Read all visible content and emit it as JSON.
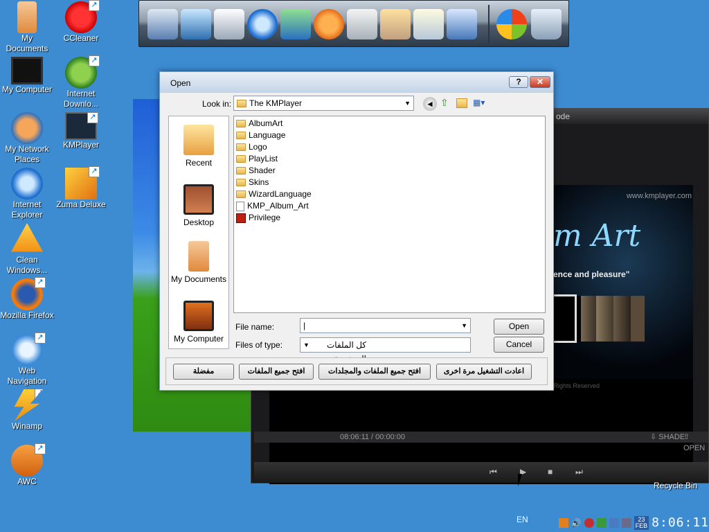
{
  "desktop": {
    "icons": [
      {
        "label": "My Documents",
        "icon": "folder-icon"
      },
      {
        "label": "CCleaner",
        "icon": "ccleaner-icon"
      },
      {
        "label": "My Computer",
        "icon": "computer-icon"
      },
      {
        "label": "Internet Downlo...",
        "icon": "download-manager-icon"
      },
      {
        "label": "My Network Places",
        "icon": "network-icon"
      },
      {
        "label": "KMPlayer",
        "icon": "kmplayer-icon"
      },
      {
        "label": "Internet Explorer",
        "icon": "ie-icon"
      },
      {
        "label": "Zuma Deluxe",
        "icon": "zuma-icon"
      },
      {
        "label": "Clean Windows...",
        "icon": "clean-icon"
      },
      {
        "label": "Mozilla Firefox",
        "icon": "firefox-icon"
      },
      {
        "label": "Web Navigation",
        "icon": "web-icon"
      },
      {
        "label": "Winamp",
        "icon": "winamp-icon"
      },
      {
        "label": "AWC",
        "icon": "awc-icon"
      }
    ],
    "recycle_bin": "Recycle Bin"
  },
  "kmplayer": {
    "title": "ode",
    "site": "www.kmplayer.com",
    "headline": "m Art",
    "tagline": "ence and pleasure\"",
    "rights": "ll Rights Reserved",
    "time": "08:06:11 / 00:00:00",
    "shade": "SHADE",
    "open": "OPEN"
  },
  "dialog": {
    "title": "Open",
    "look_in_label": "Look in:",
    "look_in_value": "The KMPlayer",
    "places": [
      "Recent",
      "Desktop",
      "My Documents",
      "My Computer"
    ],
    "files": [
      {
        "name": "AlbumArt",
        "type": "folder"
      },
      {
        "name": "Language",
        "type": "folder"
      },
      {
        "name": "Logo",
        "type": "folder"
      },
      {
        "name": "PlayList",
        "type": "folder"
      },
      {
        "name": "Shader",
        "type": "folder"
      },
      {
        "name": "Skins",
        "type": "folder"
      },
      {
        "name": "WizardLanguage",
        "type": "folder"
      },
      {
        "name": "KMP_Album_Art",
        "type": "file"
      },
      {
        "name": "Privilege",
        "type": "file"
      }
    ],
    "filename_label": "File name:",
    "filename_value": "|",
    "filetype_label": "Files of type:",
    "filetype_value": "كل الملفات المدعومة",
    "open_button": "Open",
    "cancel_button": "Cancel",
    "bottom_buttons": [
      "مفضلة",
      "افتح جميع الملفات",
      "افتح جميع الملفات والمجلدات",
      "اعادت التشغيل مرة اخرى"
    ]
  },
  "taskbar": {
    "lang": "EN",
    "date_day": "23",
    "date_month": "FEB",
    "clock": "8:06:11"
  }
}
